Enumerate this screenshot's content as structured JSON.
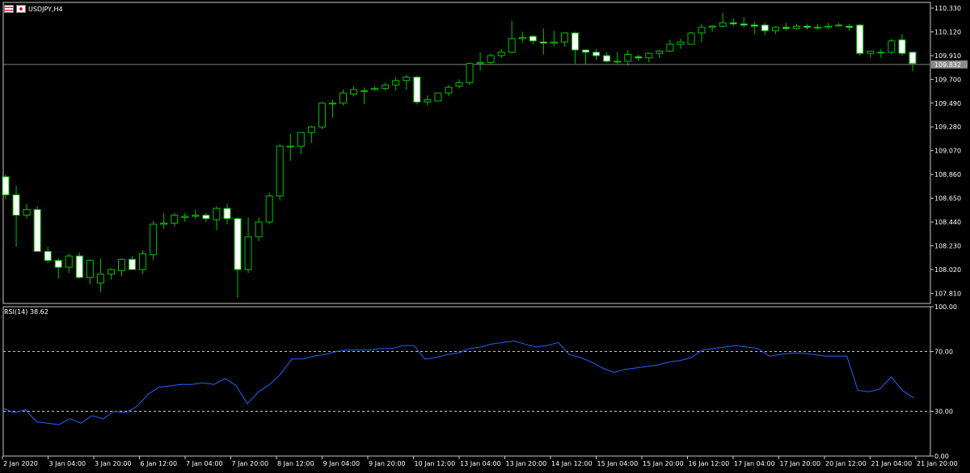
{
  "window": {
    "symbol_title": "USDJPY,H4"
  },
  "colors": {
    "background": "#000000",
    "bull": "#00c000",
    "bear_body": "#ffffff",
    "rsi_line": "#1e64ff",
    "current_price_line": "#808080"
  },
  "rsi": {
    "label": "RSI(14) 38.62"
  },
  "chart_data": [
    {
      "type": "candlestick",
      "title": "USDJPY,H4",
      "y_axis_ticks": [
        "110.330",
        "110.120",
        "109.910",
        "109.700",
        "109.490",
        "109.280",
        "109.070",
        "108.860",
        "108.650",
        "108.440",
        "108.230",
        "108.020",
        "107.810"
      ],
      "ylim": [
        107.72,
        110.38
      ],
      "current_price": 109.832,
      "current_price_label": "109.832",
      "x_tick_labels": [
        "2 Jan 2020",
        "3 Jan 04:00",
        "3 Jan 20:00",
        "6 Jan 12:00",
        "7 Jan 04:00",
        "7 Jan 20:00",
        "8 Jan 12:00",
        "9 Jan 04:00",
        "9 Jan 20:00",
        "10 Jan 12:00",
        "13 Jan 04:00",
        "13 Jan 20:00",
        "14 Jan 12:00",
        "15 Jan 04:00",
        "15 Jan 20:00",
        "16 Jan 12:00",
        "17 Jan 04:00",
        "17 Jan 20:00",
        "20 Jan 12:00",
        "21 Jan 04:00",
        "21 Jan 20:00"
      ],
      "candles": [
        [
          108.84,
          108.86,
          108.64,
          108.68
        ],
        [
          108.68,
          108.76,
          108.22,
          108.5
        ],
        [
          108.5,
          108.6,
          108.47,
          108.55
        ],
        [
          108.55,
          108.58,
          108.18,
          108.18
        ],
        [
          108.18,
          108.22,
          108.08,
          108.1
        ],
        [
          108.1,
          108.12,
          107.94,
          108.04
        ],
        [
          108.04,
          108.16,
          107.99,
          108.14
        ],
        [
          108.14,
          108.17,
          107.94,
          107.95
        ],
        [
          107.95,
          108.11,
          107.89,
          108.1
        ],
        [
          107.9,
          108.12,
          107.82,
          107.98
        ],
        [
          107.98,
          108.03,
          107.93,
          108.02
        ],
        [
          108.01,
          108.12,
          107.96,
          108.11
        ],
        [
          108.11,
          108.14,
          108.03,
          108.02
        ],
        [
          108.02,
          108.19,
          107.98,
          108.16
        ],
        [
          108.15,
          108.45,
          108.1,
          108.42
        ],
        [
          108.42,
          108.52,
          108.38,
          108.43
        ],
        [
          108.43,
          108.52,
          108.4,
          108.5
        ],
        [
          108.48,
          108.52,
          108.44,
          108.49
        ],
        [
          108.49,
          108.55,
          108.47,
          108.5
        ],
        [
          108.5,
          108.52,
          108.44,
          108.47
        ],
        [
          108.46,
          108.58,
          108.37,
          108.56
        ],
        [
          108.56,
          108.6,
          108.42,
          108.47
        ],
        [
          108.47,
          108.48,
          107.77,
          108.02
        ],
        [
          108.02,
          108.48,
          107.99,
          108.31
        ],
        [
          108.31,
          108.48,
          108.27,
          108.44
        ],
        [
          108.44,
          108.7,
          108.42,
          108.67
        ],
        [
          108.67,
          109.13,
          108.63,
          109.11
        ],
        [
          109.11,
          109.22,
          108.98,
          109.11
        ],
        [
          109.11,
          109.23,
          109.04,
          109.23
        ],
        [
          109.23,
          109.29,
          109.14,
          109.28
        ],
        [
          109.28,
          109.5,
          109.26,
          109.49
        ],
        [
          109.49,
          109.52,
          109.36,
          109.49
        ],
        [
          109.49,
          109.61,
          109.47,
          109.58
        ],
        [
          109.57,
          109.64,
          109.55,
          109.61
        ],
        [
          109.6,
          109.63,
          109.48,
          109.6
        ],
        [
          109.61,
          109.64,
          109.6,
          109.62
        ],
        [
          109.62,
          109.67,
          109.6,
          109.65
        ],
        [
          109.65,
          109.72,
          109.6,
          109.69
        ],
        [
          109.69,
          109.74,
          109.61,
          109.72
        ],
        [
          109.72,
          109.73,
          109.48,
          109.5
        ],
        [
          109.5,
          109.56,
          109.47,
          109.52
        ],
        [
          109.51,
          109.58,
          109.51,
          109.58
        ],
        [
          109.58,
          109.65,
          109.55,
          109.63
        ],
        [
          109.64,
          109.7,
          109.62,
          109.67
        ],
        [
          109.67,
          109.85,
          109.65,
          109.84
        ],
        [
          109.84,
          109.94,
          109.78,
          109.85
        ],
        [
          109.85,
          109.93,
          109.83,
          109.91
        ],
        [
          109.91,
          109.97,
          109.89,
          109.94
        ],
        [
          109.94,
          110.22,
          109.93,
          110.06
        ],
        [
          110.06,
          110.12,
          110.03,
          110.07
        ],
        [
          110.08,
          110.09,
          110.01,
          110.04
        ],
        [
          110.03,
          110.15,
          109.92,
          110.02
        ],
        [
          110.02,
          110.13,
          109.99,
          110.03
        ],
        [
          110.03,
          110.11,
          109.99,
          110.11
        ],
        [
          110.11,
          110.12,
          109.84,
          109.96
        ],
        [
          109.96,
          109.96,
          109.83,
          109.94
        ],
        [
          109.94,
          109.97,
          109.87,
          109.91
        ],
        [
          109.91,
          109.94,
          109.85,
          109.86
        ],
        [
          109.86,
          109.94,
          109.84,
          109.86
        ],
        [
          109.86,
          109.96,
          109.82,
          109.92
        ],
        [
          109.9,
          109.92,
          109.86,
          109.89
        ],
        [
          109.89,
          109.94,
          109.85,
          109.93
        ],
        [
          109.93,
          109.96,
          109.89,
          109.95
        ],
        [
          109.95,
          110.05,
          109.94,
          110.01
        ],
        [
          110.01,
          110.06,
          109.97,
          110.03
        ],
        [
          110.01,
          110.12,
          110.03,
          110.11
        ],
        [
          110.11,
          110.19,
          110.03,
          110.16
        ],
        [
          110.16,
          110.18,
          110.12,
          110.17
        ],
        [
          110.17,
          110.29,
          110.16,
          110.2
        ],
        [
          110.2,
          110.24,
          110.17,
          110.19
        ],
        [
          110.19,
          110.25,
          110.16,
          110.18
        ],
        [
          110.18,
          110.21,
          110.1,
          110.17
        ],
        [
          110.18,
          110.2,
          110.09,
          110.13
        ],
        [
          110.13,
          110.17,
          110.1,
          110.16
        ],
        [
          110.16,
          110.2,
          110.13,
          110.15
        ],
        [
          110.15,
          110.19,
          110.14,
          110.17
        ],
        [
          110.17,
          110.19,
          110.14,
          110.16
        ],
        [
          110.16,
          110.19,
          110.14,
          110.16
        ],
        [
          110.16,
          110.2,
          110.14,
          110.17
        ],
        [
          110.18,
          110.2,
          110.17,
          110.18
        ],
        [
          110.17,
          110.19,
          110.13,
          110.16
        ],
        [
          110.18,
          110.19,
          109.91,
          109.93
        ],
        [
          109.93,
          109.95,
          109.89,
          109.95
        ],
        [
          109.94,
          109.97,
          109.89,
          109.94
        ],
        [
          109.94,
          110.06,
          109.92,
          110.04
        ],
        [
          110.05,
          110.1,
          109.91,
          109.93
        ],
        [
          109.94,
          109.94,
          109.77,
          109.84
        ]
      ]
    },
    {
      "type": "line",
      "title": "RSI(14) 38.62",
      "ylim": [
        0,
        100
      ],
      "y_axis_ticks": [
        "100.00",
        "70.00",
        "30.00",
        "0.00"
      ],
      "levels": [
        70,
        30
      ],
      "series": [
        {
          "name": "RSI(14)",
          "values": [
            32,
            29,
            31,
            23,
            22,
            21,
            25,
            22,
            27,
            25,
            30,
            29,
            33,
            41,
            46,
            47,
            48,
            48,
            49,
            48,
            52,
            47,
            35,
            43,
            48,
            55,
            65,
            65,
            67,
            68,
            70,
            71,
            71,
            71,
            72,
            72,
            74,
            74,
            65,
            66,
            68,
            69,
            72,
            73,
            75,
            76,
            77,
            75,
            73,
            74,
            76,
            68,
            66,
            63,
            59,
            56,
            58,
            59,
            60,
            61,
            63,
            64,
            66,
            71,
            72,
            73,
            74,
            73,
            72,
            67,
            68,
            69,
            69,
            68,
            67,
            67,
            67,
            44,
            43,
            45,
            53,
            44,
            39
          ]
        }
      ]
    }
  ]
}
